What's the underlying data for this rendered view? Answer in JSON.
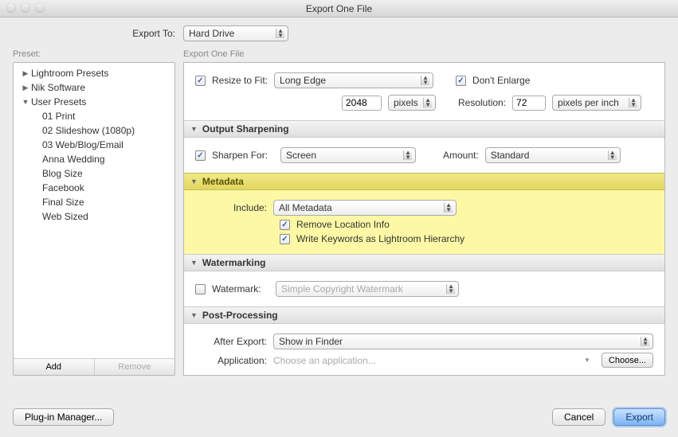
{
  "window": {
    "title": "Export One File"
  },
  "exportTo": {
    "label": "Export To:",
    "value": "Hard Drive"
  },
  "presets": {
    "header": "Preset:",
    "groups": [
      {
        "label": "Lightroom Presets",
        "collapsed": true
      },
      {
        "label": "Nik Software",
        "collapsed": true
      },
      {
        "label": "User Presets",
        "collapsed": false
      }
    ],
    "userItems": [
      "01 Print",
      "02 Slideshow (1080p)",
      "03 Web/Blog/Email",
      "Anna Wedding",
      "Blog Size",
      "Facebook",
      "Final Size",
      "Web Sized"
    ],
    "addLabel": "Add",
    "removeLabel": "Remove"
  },
  "panelsHeader": "Export One File",
  "resize": {
    "checkLabel": "Resize to Fit:",
    "mode": "Long Edge",
    "dontEnlarge": "Don't Enlarge",
    "value": "2048",
    "unit": "pixels",
    "resolutionLabel": "Resolution:",
    "resolutionValue": "72",
    "resolutionUnit": "pixels per inch"
  },
  "sharpen": {
    "title": "Output Sharpening",
    "checkLabel": "Sharpen For:",
    "target": "Screen",
    "amountLabel": "Amount:",
    "amount": "Standard"
  },
  "metadata": {
    "title": "Metadata",
    "includeLabel": "Include:",
    "includeValue": "All Metadata",
    "removeLocation": "Remove Location Info",
    "writeKeywords": "Write Keywords as Lightroom Hierarchy"
  },
  "watermark": {
    "title": "Watermarking",
    "checkLabel": "Watermark:",
    "preset": "Simple Copyright Watermark"
  },
  "post": {
    "title": "Post-Processing",
    "afterLabel": "After Export:",
    "afterValue": "Show in Finder",
    "appLabel": "Application:",
    "appPlaceholder": "Choose an application...",
    "chooseLabel": "Choose..."
  },
  "footer": {
    "plugin": "Plug-in Manager...",
    "cancel": "Cancel",
    "export": "Export"
  }
}
